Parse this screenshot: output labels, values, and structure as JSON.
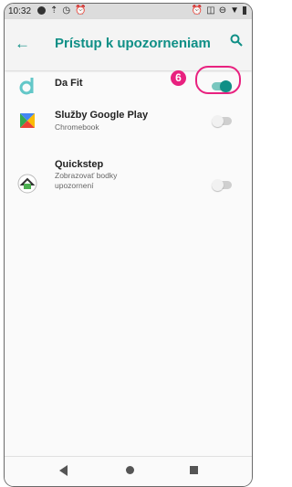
{
  "status_bar": {
    "time": "10:32"
  },
  "app_bar": {
    "title": "Prístup k upozorneniam"
  },
  "items": [
    {
      "title": "Da Fit",
      "subtitle": "",
      "enabled": true
    },
    {
      "title": "Služby Google Play",
      "subtitle": "Chromebook",
      "enabled": false
    },
    {
      "title": "Quickstep",
      "subtitle": "Zobrazovať bodky upozornení",
      "enabled": false
    }
  ],
  "annotation": {
    "number": "6"
  },
  "colors": {
    "accent": "#0f8f86",
    "highlight": "#e8217f",
    "toggle_off_track": "#cfcfcf",
    "toggle_off_thumb": "#f1f1f1"
  }
}
